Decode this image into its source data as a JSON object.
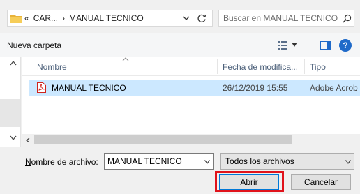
{
  "address": {
    "prefix": "«",
    "crumb1": "CAR...",
    "separator": "›",
    "crumb2": "MANUAL TECNICO"
  },
  "search": {
    "placeholder": "Buscar en MANUAL TECNICO"
  },
  "toolbar": {
    "new_folder": "Nueva carpeta",
    "help": "?"
  },
  "columns": {
    "name": "Nombre",
    "date": "Fecha de modifica...",
    "type": "Tipo"
  },
  "files": [
    {
      "name": "MANUAL TECNICO",
      "date": "26/12/2019 15:55",
      "type": "Adobe Acrob"
    }
  ],
  "footer": {
    "filename_label_accel": "N",
    "filename_label_rest": "ombre de archivo:",
    "filename_value": "MANUAL TECNICO",
    "filter_value": "Todos los archivos",
    "open_accel": "A",
    "open_rest": "brir",
    "cancel": "Cancelar"
  },
  "colors": {
    "selection": "#cce8ff",
    "highlight": "#e0131b",
    "accent": "#0078d7"
  }
}
